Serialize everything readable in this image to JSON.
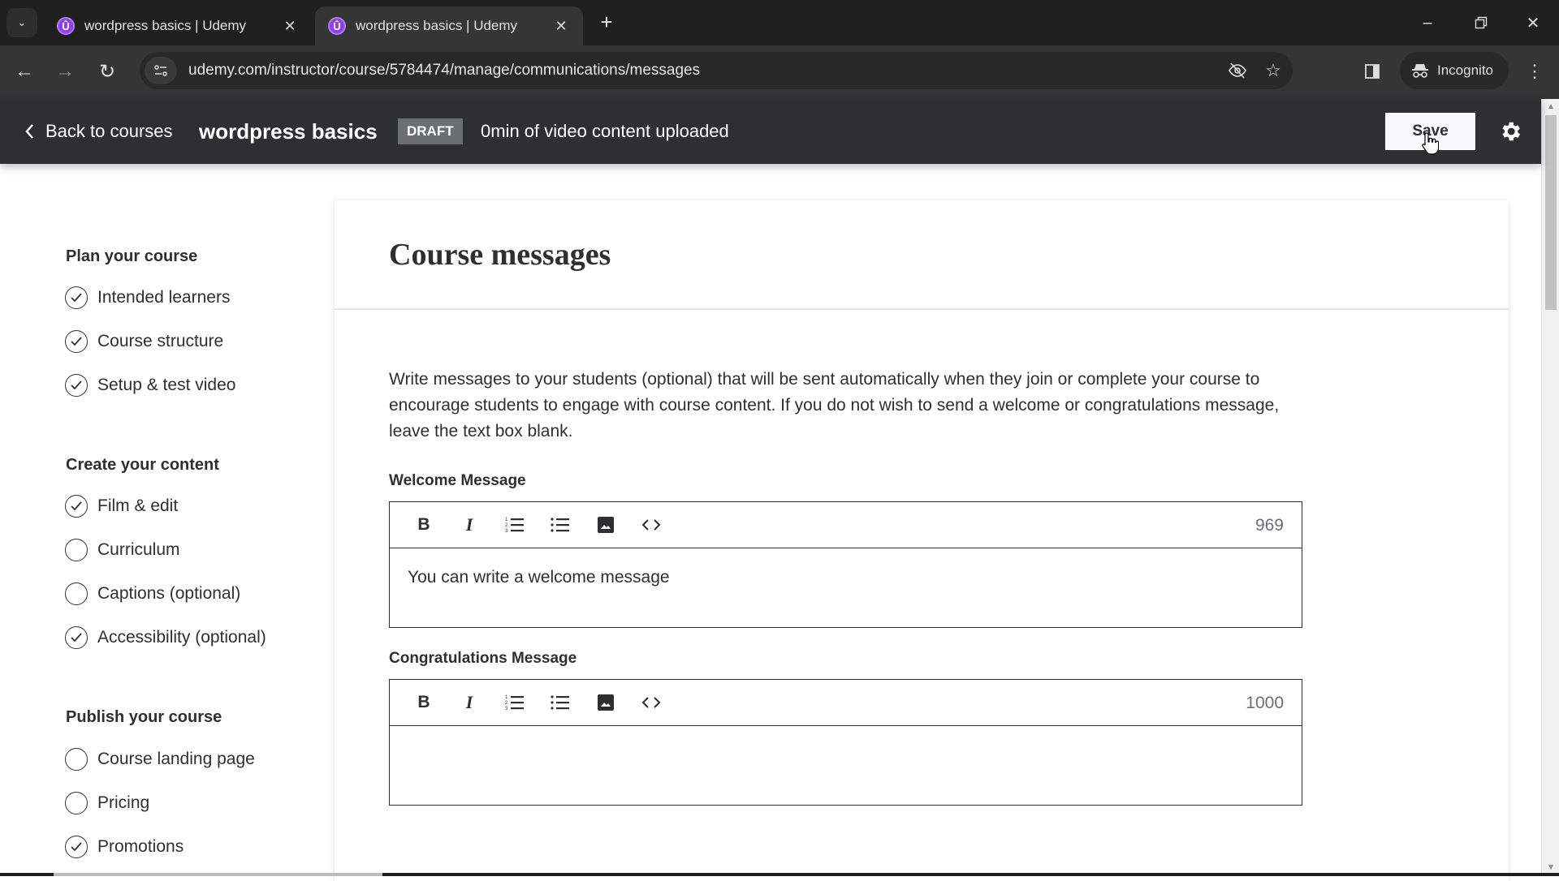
{
  "browser": {
    "tabs": [
      {
        "title": "wordpress basics | Udemy",
        "favicon": "udemy-icon",
        "active": false
      },
      {
        "title": "wordpress basics | Udemy",
        "favicon": "udemy-icon",
        "active": true
      }
    ],
    "url": "udemy.com/instructor/course/5784474/manage/communications/messages",
    "incognito_label": "Incognito",
    "favicon_letter": "Û"
  },
  "header": {
    "back_label": "Back to courses",
    "course_title": "wordpress basics",
    "status_badge": "DRAFT",
    "upload_status": "0min of video content uploaded",
    "save_label": "Save"
  },
  "sidebar": {
    "sections": [
      {
        "heading": "Plan your course",
        "items": [
          {
            "label": "Intended learners",
            "done": true
          },
          {
            "label": "Course structure",
            "done": true
          },
          {
            "label": "Setup & test video",
            "done": true
          }
        ]
      },
      {
        "heading": "Create your content",
        "items": [
          {
            "label": "Film & edit",
            "done": true
          },
          {
            "label": "Curriculum",
            "done": false
          },
          {
            "label": "Captions (optional)",
            "done": false
          },
          {
            "label": "Accessibility (optional)",
            "done": true
          }
        ]
      },
      {
        "heading": "Publish your course",
        "items": [
          {
            "label": "Course landing page",
            "done": false
          },
          {
            "label": "Pricing",
            "done": false
          },
          {
            "label": "Promotions",
            "done": true
          }
        ]
      }
    ]
  },
  "main": {
    "title": "Course messages",
    "intro": "Write messages to your students (optional) that will be sent automatically when they join or complete your course to encourage students to engage with course content. If you do not wish to send a welcome or congratulations message, leave the text box blank.",
    "welcome": {
      "label": "Welcome Message",
      "value": "You can write a welcome message",
      "char_count": "969"
    },
    "congratulations": {
      "label": "Congratulations Message",
      "value": "",
      "char_count": "1000"
    },
    "toolbar_tools": [
      "bold",
      "italic",
      "numbered-list",
      "bulleted-list",
      "image",
      "code"
    ]
  }
}
